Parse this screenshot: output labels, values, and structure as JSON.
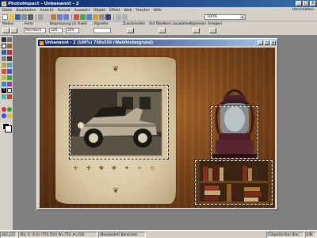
{
  "app": {
    "title": "PhotoImpact - Unbenannt - 2"
  },
  "menu": [
    "Datei",
    "Bearbeiten",
    "Ansicht",
    "Format",
    "Auswahl",
    "Objekt",
    "Effekt",
    "Web",
    "Fenster",
    "Hilfe"
  ],
  "menu_right": "Umschalten",
  "zoom": "100%",
  "options": {
    "modus_label": "Modus",
    "form_label": "Form",
    "begrenzung_label": "Begrenzung (in Pixel)",
    "vignette_label": "Vignette",
    "zuschneiden_label": "Zuschneiden",
    "auf_objekten_label": "Auf Objekten auswählen",
    "optionen_label": "Optionen",
    "anlegen_label": "Anlegen",
    "form_value": "Rechteck",
    "breite_value": "320",
    "hoehe_value": "240"
  },
  "document": {
    "title": "Unbenannt - 2 (100%) 750x550 (Wahlhintergrund)"
  },
  "canvas": {
    "top_ornament": "❦",
    "bottom_ornament": "❦",
    "glyph_row": "✢ ✣ ✤ ✥ ✦ ✧ ✩"
  },
  "statusbar": {
    "coords": "362,221",
    "obj": "Obj: 0: (0,0) (750,550) W=750, H=550",
    "hint": "[Bearbeitet] Bereichen",
    "right1": "Füllgelöschter Bloc",
    "right2": "EIN"
  },
  "colors": {
    "title_blue": "#0a246a",
    "chrome": "#d4d0c8",
    "wood": "#7a4419",
    "paper": "#e0d2b2"
  }
}
